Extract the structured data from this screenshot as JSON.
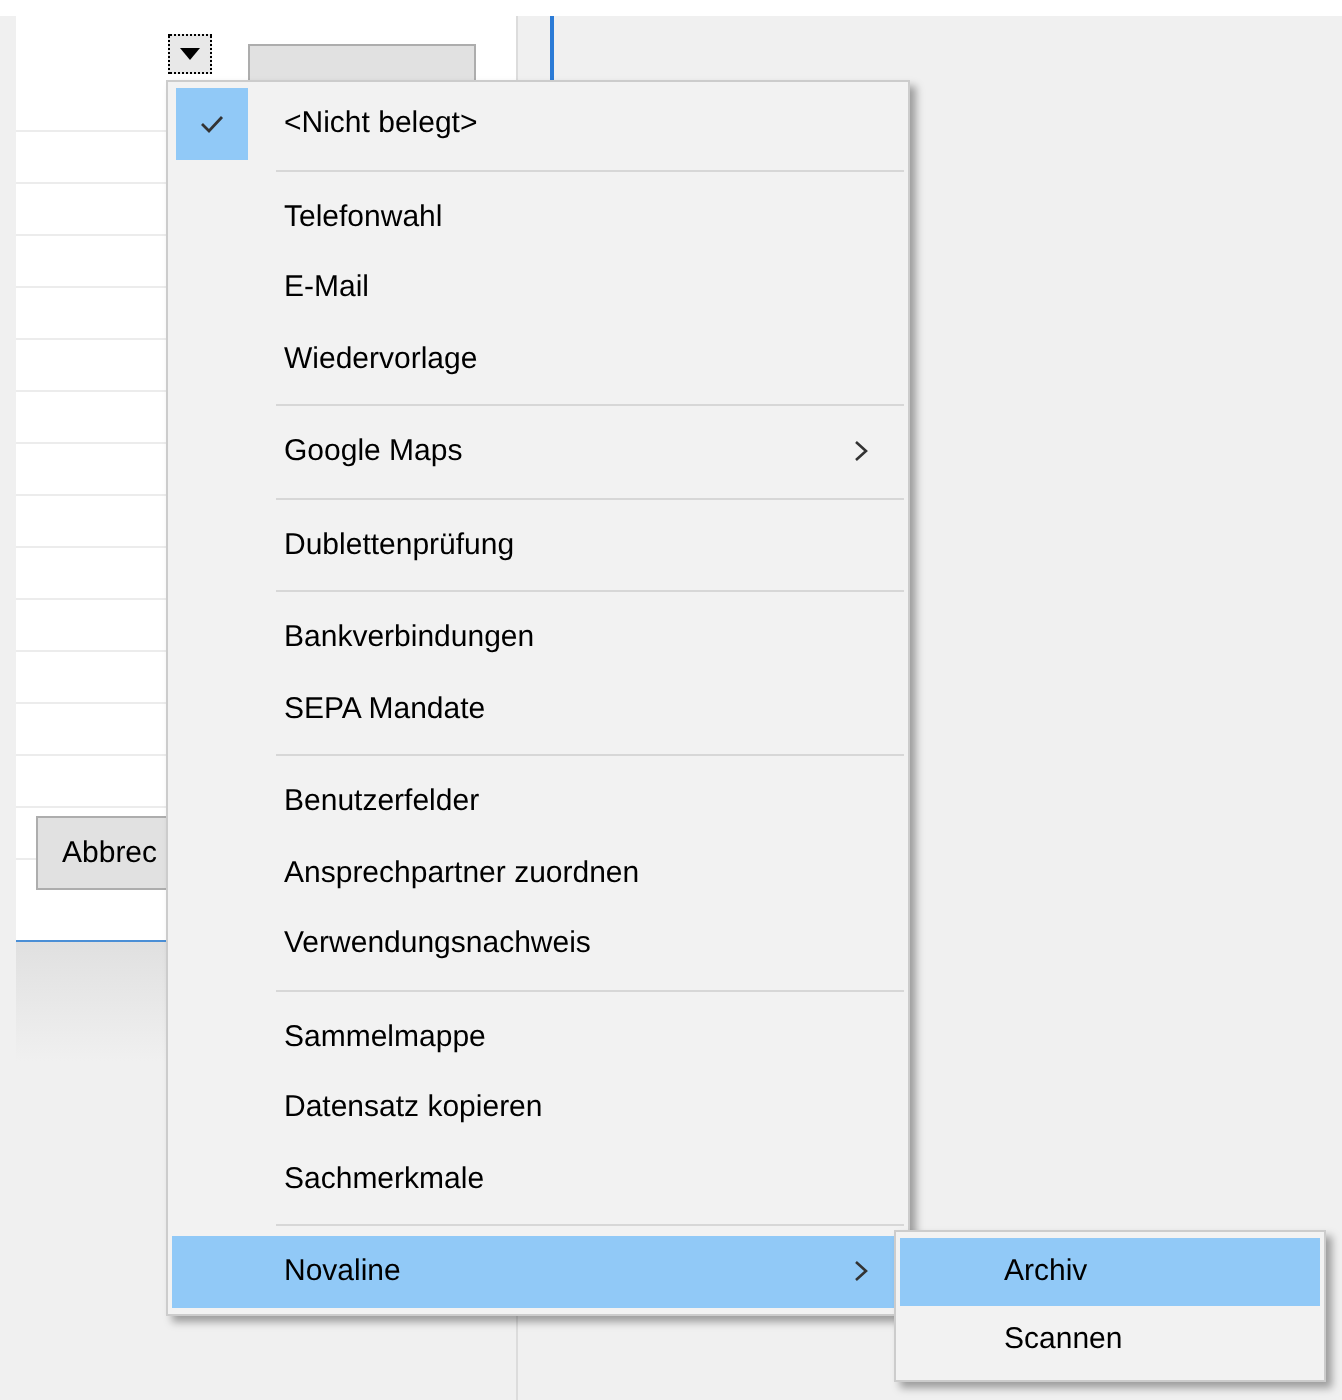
{
  "dialog": {
    "cancel_button": "Abbrec"
  },
  "context_menu": {
    "groups": [
      [
        {
          "label": "<Nicht belegt>",
          "checked": true,
          "selected": false,
          "submenu": false
        }
      ],
      [
        {
          "label": "Telefonwahl",
          "checked": false,
          "selected": false,
          "submenu": false
        },
        {
          "label": "E-Mail",
          "checked": false,
          "selected": false,
          "submenu": false
        },
        {
          "label": "Wiedervorlage",
          "checked": false,
          "selected": false,
          "submenu": false
        }
      ],
      [
        {
          "label": "Google Maps",
          "checked": false,
          "selected": false,
          "submenu": true
        }
      ],
      [
        {
          "label": "Dublettenprüfung",
          "checked": false,
          "selected": false,
          "submenu": false
        }
      ],
      [
        {
          "label": "Bankverbindungen",
          "checked": false,
          "selected": false,
          "submenu": false
        },
        {
          "label": "SEPA Mandate",
          "checked": false,
          "selected": false,
          "submenu": false
        }
      ],
      [
        {
          "label": "Benutzerfelder",
          "checked": false,
          "selected": false,
          "submenu": false
        },
        {
          "label": "Ansprechpartner zuordnen",
          "checked": false,
          "selected": false,
          "submenu": false
        },
        {
          "label": "Verwendungsnachweis",
          "checked": false,
          "selected": false,
          "submenu": false
        }
      ],
      [
        {
          "label": "Sammelmappe",
          "checked": false,
          "selected": false,
          "submenu": false
        },
        {
          "label": "Datensatz kopieren",
          "checked": false,
          "selected": false,
          "submenu": false
        },
        {
          "label": "Sachmerkmale",
          "checked": false,
          "selected": false,
          "submenu": false
        }
      ],
      [
        {
          "label": "Novaline",
          "checked": false,
          "selected": true,
          "submenu": true
        }
      ]
    ]
  },
  "submenu": {
    "items": [
      {
        "label": "Archiv",
        "selected": true
      },
      {
        "label": "Scannen",
        "selected": false
      }
    ]
  }
}
